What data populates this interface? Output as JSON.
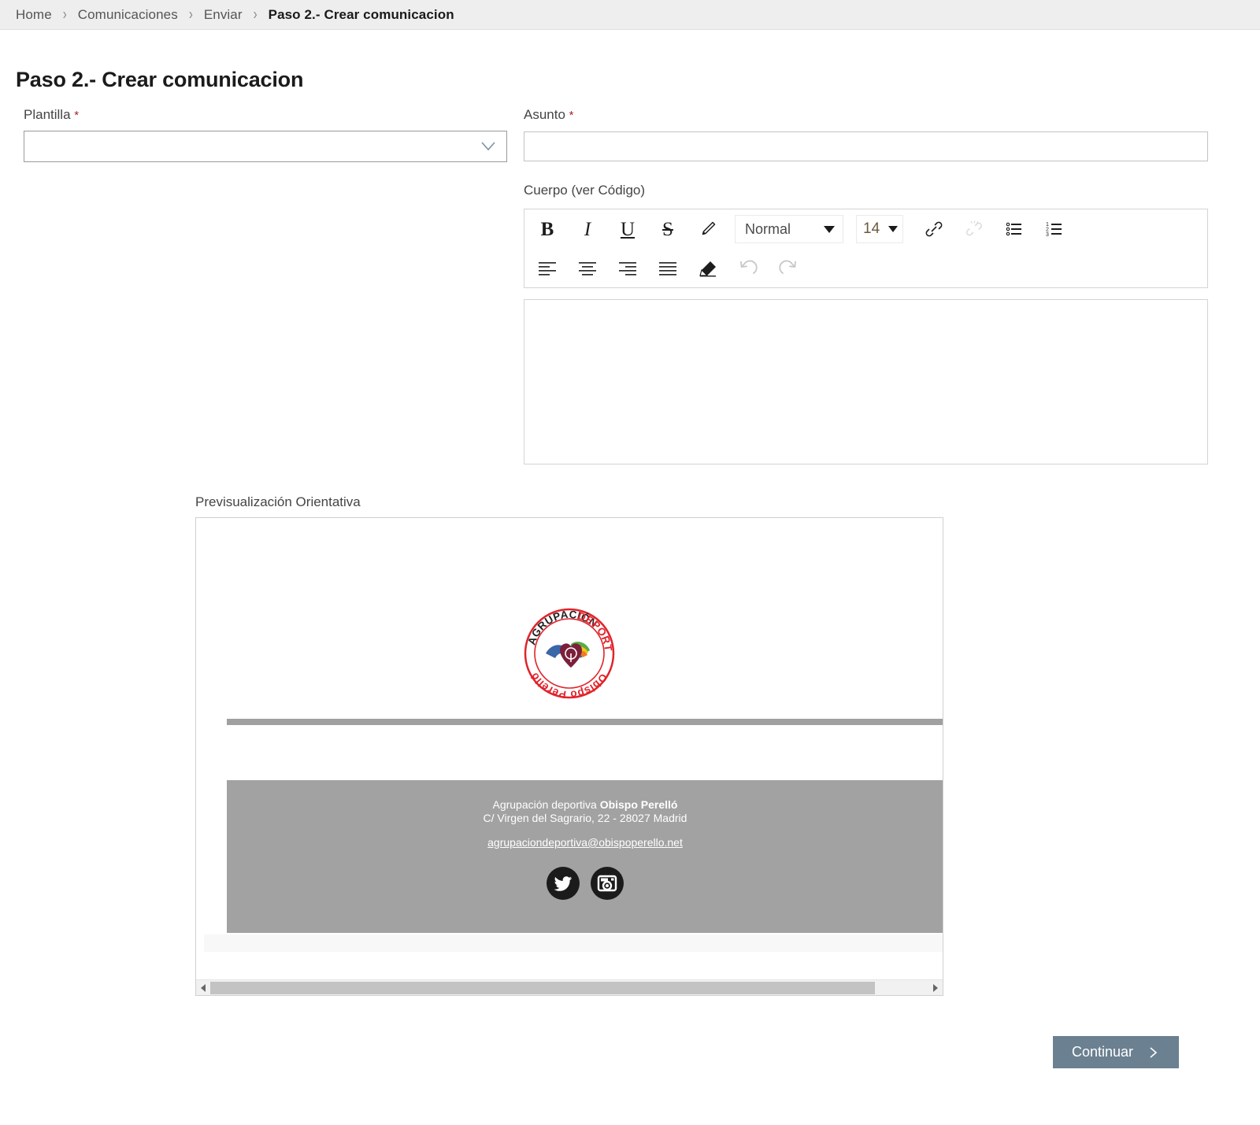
{
  "breadcrumb": {
    "items": [
      {
        "label": "Home",
        "active": false
      },
      {
        "label": "Comunicaciones",
        "active": false
      },
      {
        "label": "Enviar",
        "active": false
      },
      {
        "label": "Paso 2.- Crear comunicacion",
        "active": true
      }
    ],
    "separator": "›"
  },
  "page": {
    "title": "Paso 2.- Crear comunicacion"
  },
  "form": {
    "plantilla": {
      "label": "Plantilla",
      "required_mark": "*",
      "value": "",
      "placeholder": ""
    },
    "asunto": {
      "label": "Asunto",
      "required_mark": "*",
      "value": "",
      "placeholder": ""
    },
    "cuerpo": {
      "label": "Cuerpo (ver Código)",
      "value": "",
      "placeholder": ""
    }
  },
  "editor_toolbar": {
    "row1": [
      {
        "name": "bold-icon",
        "glyph": "B",
        "style": "bold",
        "disabled": false
      },
      {
        "name": "italic-icon",
        "glyph": "I",
        "style": "ital",
        "disabled": false
      },
      {
        "name": "underline-icon",
        "glyph": "U",
        "style": "und",
        "disabled": false
      },
      {
        "name": "strikethrough-icon",
        "glyph": "S",
        "style": "strike",
        "disabled": false
      }
    ],
    "pen_icon": "pen-icon",
    "format_select": {
      "value": "Normal",
      "name": "format-select"
    },
    "size_select": {
      "value": "14",
      "name": "font-size-select"
    },
    "link_icon": "link-icon",
    "unlink_icon": "unlink-icon",
    "bullet_list_icon": "bullet-list-icon",
    "numbered_list_icon": "numbered-list-icon",
    "row2": [
      {
        "name": "align-left-icon"
      },
      {
        "name": "align-center-icon"
      },
      {
        "name": "align-right-icon"
      },
      {
        "name": "align-justify-icon"
      },
      {
        "name": "clear-format-icon"
      },
      {
        "name": "undo-icon"
      },
      {
        "name": "redo-icon"
      }
    ]
  },
  "preview": {
    "label": "Previsualización Orientativa",
    "logo": {
      "name": "agrupacion-deportiva-obispo-perello-logo",
      "top_text": "AGRUPACIÓN DEPORTIVA",
      "bottom_text": "Obispo Perelló",
      "colors": {
        "red": "#e1232b",
        "dark": "#231f20",
        "heart": "#7b1f3a",
        "blue": "#2e5fa3",
        "green": "#5aab46",
        "yellow": "#f5c518",
        "orange": "#ef7d22"
      }
    },
    "divider_color": "#a0a0a0",
    "footer": {
      "background": "#a2a2a2",
      "line1_plain": "Agrupación deportiva ",
      "line1_bold": "Obispo Perelló",
      "line2": "C/ Virgen del Sagrario, 22 - 28027 Madrid",
      "email": "agrupaciondeportiva@obispoperello.net",
      "social": [
        {
          "name": "twitter-icon"
        },
        {
          "name": "instagram-icon"
        }
      ]
    },
    "scrollbar": {
      "left_arrow": "scroll-left-arrow",
      "right_arrow": "scroll-right-arrow",
      "thumb_percent": 92
    }
  },
  "footer_actions": {
    "continuar": {
      "label": "Continuar",
      "icon": "chevron-right-icon",
      "color": "#6b8090"
    }
  }
}
